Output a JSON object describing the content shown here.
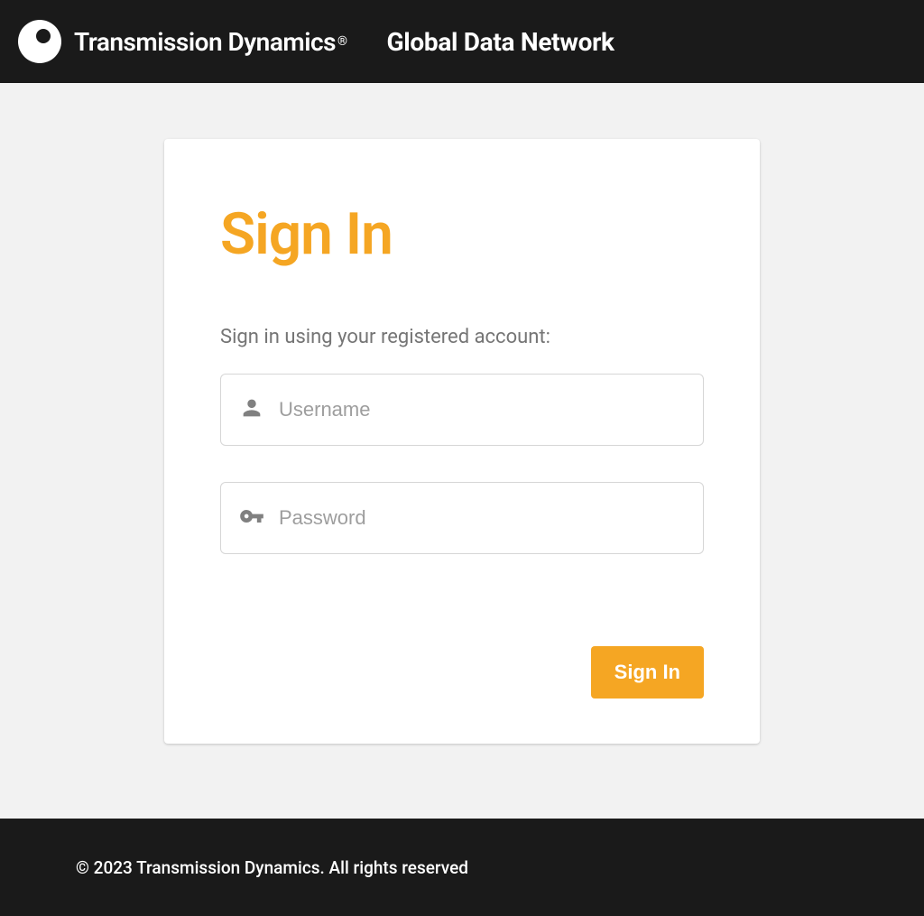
{
  "header": {
    "brand_name": "Transmission Dynamics",
    "registered_mark": "®",
    "app_title": "Global Data Network"
  },
  "card": {
    "title": "Sign In",
    "subtitle": "Sign in using your registered account:",
    "username_placeholder": "Username",
    "password_placeholder": "Password",
    "button_label": "Sign In"
  },
  "footer": {
    "copyright": "© 2023 Transmission Dynamics. All rights reserved"
  },
  "colors": {
    "header_bg": "#1a1a1a",
    "accent": "#f5a623",
    "page_bg": "#f2f2f2",
    "card_bg": "#ffffff"
  }
}
